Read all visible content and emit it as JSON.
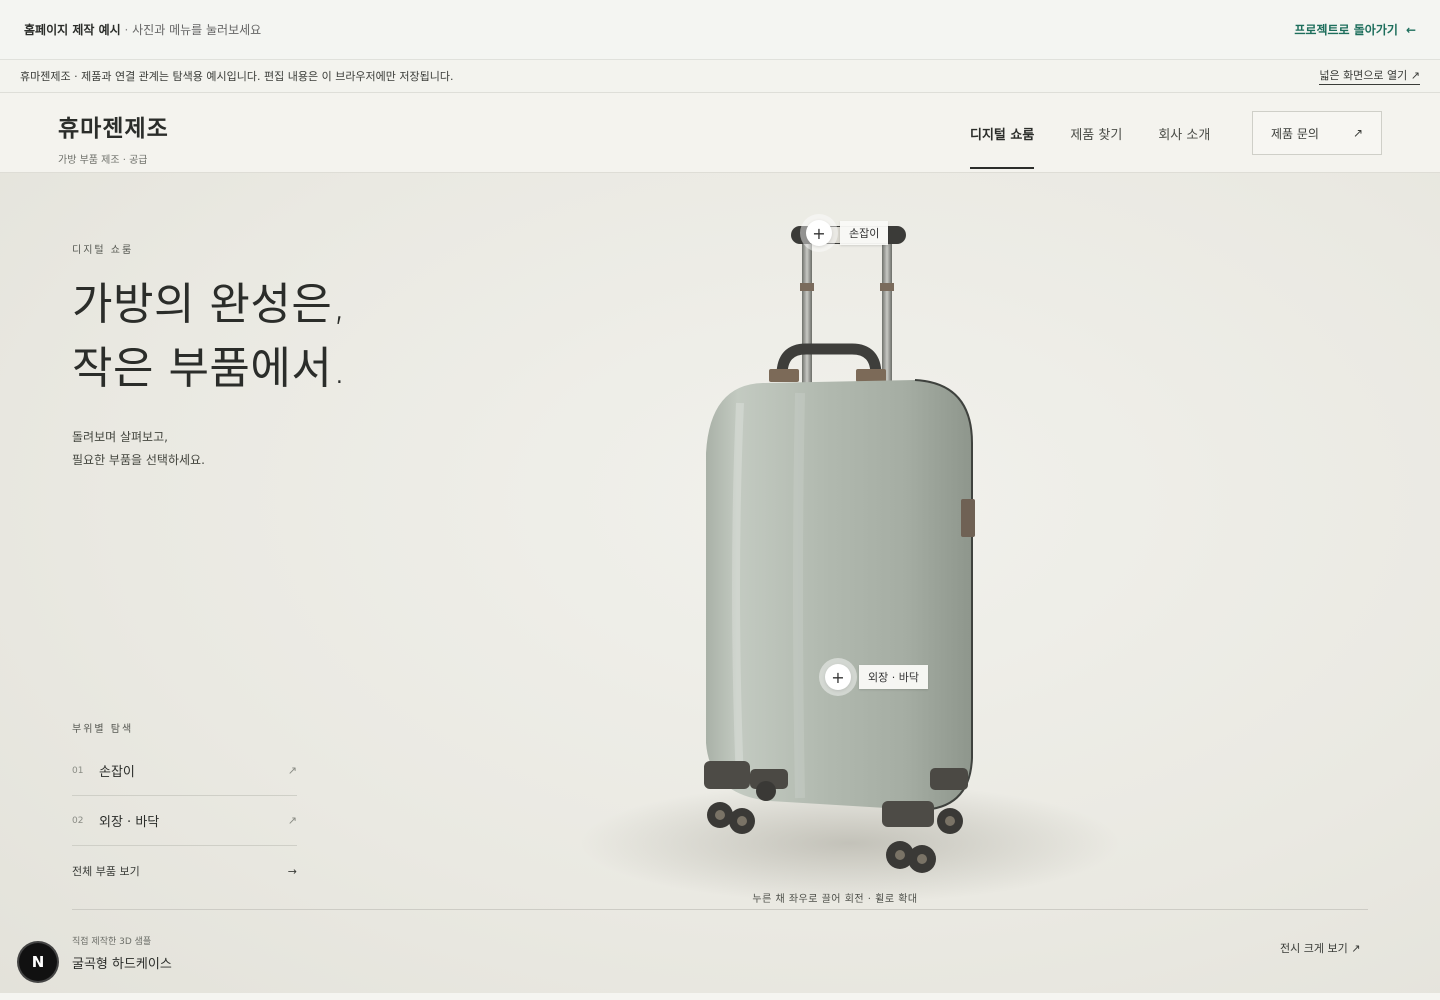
{
  "topbar": {
    "title": "홈페이지 제작 예시",
    "separator": " · ",
    "hint": "사진과 메뉴를 눌러보세요",
    "back_label": "프로젝트로 돌아가기",
    "back_icon": "←"
  },
  "notice": {
    "text": "휴마젠제조 · 제품과 연결 관계는 탐색용 예시입니다. 편집 내용은 이 브라우저에만 저장됩니다.",
    "open_label": "넓은 화면으로 열기 ↗"
  },
  "header": {
    "brand_name": "휴마젠제조",
    "brand_sub": "가방 부품 제조 · 공급",
    "nav": [
      {
        "label": "디지털 쇼룸",
        "active": true
      },
      {
        "label": "제품 찾기",
        "active": false
      },
      {
        "label": "회사 소개",
        "active": false
      }
    ],
    "contact_label": "제품 문의",
    "contact_icon": "↗"
  },
  "hero": {
    "eyebrow": "디지털 쇼룸",
    "headline_line1": "가방의 완성은,",
    "headline_line2": "작은 부품에서.",
    "desc_line1": "돌려보며 살펴보고,",
    "desc_line2": "필요한 부품을 선택하세요.",
    "parts_label": "부위별 탐색",
    "parts": [
      {
        "num": "01",
        "label": "손잡이",
        "icon": "↗"
      },
      {
        "num": "02",
        "label": "외장 · 바닥",
        "icon": "↗"
      }
    ],
    "all_parts_label": "전체 부품 보기",
    "all_parts_icon": "→",
    "hotspots": [
      {
        "label": "손잡이",
        "icon": "+"
      },
      {
        "label": "외장 · 바닥",
        "icon": "+"
      }
    ],
    "rotate_hint": "누른 채 좌우로 끌어 회전 · 휠로 확대",
    "sample_label": "직접 제작한 3D 샘플",
    "sample_name": "굴곡형 하드케이스",
    "big_view_label": "전시 크게 보기 ↗"
  },
  "badge": {
    "letter": "N"
  },
  "colors": {
    "accent": "#1d6e5c",
    "background": "#eeeee8",
    "suitcase": "#a9b2a8",
    "text": "#2b2d2a"
  }
}
